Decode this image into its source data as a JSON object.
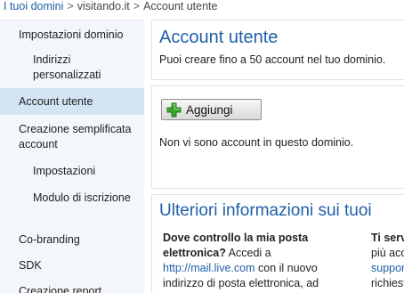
{
  "breadcrumb": {
    "root": "I tuoi domini",
    "domain": "visitando.it",
    "current": "Account utente",
    "separator": ">"
  },
  "sidebar": {
    "items": [
      {
        "label": "Impostazioni dominio",
        "level": "top"
      },
      {
        "label": "Indirizzi personalizzati",
        "level": "sub"
      },
      {
        "label": "Account utente",
        "level": "top",
        "active": true
      },
      {
        "label": "Creazione semplificata account",
        "level": "top"
      },
      {
        "label": "Impostazioni",
        "level": "sub"
      },
      {
        "label": "Modulo di iscrizione",
        "level": "sub"
      },
      {
        "label": "Co-branding",
        "level": "top"
      },
      {
        "label": "SDK",
        "level": "top"
      },
      {
        "label": "Creazione report",
        "level": "top"
      }
    ]
  },
  "header": {
    "title": "Account utente",
    "subtitle": "Puoi creare fino a 50 account nel tuo dominio."
  },
  "accounts": {
    "add_button_label": "Aggiungi",
    "add_icon": "plus-icon",
    "empty_message": "Non vi sono account in questo dominio."
  },
  "info": {
    "title": "Ulteriori informazioni sui tuoi",
    "col1_question": "Dove controllo la mia posta elettronica?",
    "col1_text_before_link": "Accedi a",
    "col1_link": "http://mail.live.com",
    "col1_text_after_link": "con il nuovo indirizzo di posta elettronica, ad esempio info@wingtiptoys.com.",
    "col2_line1": "Ti serv",
    "col2_line2": "più acc",
    "col2_link": "suppor",
    "col2_line4": "richiest"
  },
  "colors": {
    "link": "#1f5fa9",
    "active_nav": "#d3e5f5",
    "sidebar_bg": "#f3f6fa",
    "plus_green": "#3aa52e"
  }
}
